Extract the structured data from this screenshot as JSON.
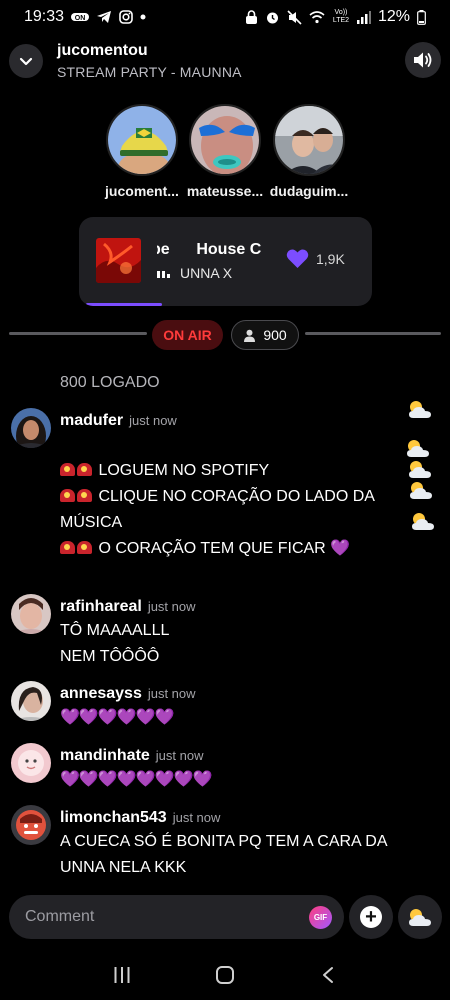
{
  "status_bar": {
    "time": "19:33",
    "lte_label": "Vo)) LTE2",
    "battery": "12%"
  },
  "header": {
    "host": "jucomentou",
    "party_title": "STREAM PARTY - MAUNNA"
  },
  "participants": [
    {
      "name": "jucoment...",
      "icon": "cap-avatar"
    },
    {
      "name": "mateusse...",
      "icon": "face-avatar"
    },
    {
      "name": "dudaguim...",
      "icon": "photo-avatar"
    }
  ],
  "now_playing": {
    "title": "pe      House C",
    "artist": "UNNA X",
    "likes": "1,9K",
    "progress_percent": 26
  },
  "live": {
    "onair_label": "ON AIR",
    "viewers": "900"
  },
  "chat": {
    "note": "800 LOGADO",
    "messages": [
      {
        "user": "madufer",
        "time": "just now",
        "lines": [
          "LOGUEM NO SPOTIFY",
          "CLIQUE NO CORAÇÃO DO LADO DA",
          "MÚSICA",
          "O CORAÇÃO TEM QUE FICAR"
        ]
      },
      {
        "user": "rafinhareal",
        "time": "just now",
        "lines": [
          "TÔ MAAAALLL",
          "NEM TÔÔÔÔ"
        ]
      },
      {
        "user": "annesayss",
        "time": "just now",
        "lines": [
          "💜💜💜💜💜💜"
        ]
      },
      {
        "user": "mandinhate",
        "time": "just now",
        "lines": [
          "💜💜💜💜💜💜💜💜"
        ]
      },
      {
        "user": "limonchan543",
        "time": "just now",
        "lines": [
          "A CUECA SÓ É BONITA PQ TEM A CARA DA",
          "UNNA NELA KKK"
        ]
      }
    ],
    "heart_emoji": "💜"
  },
  "composer": {
    "placeholder": "Comment",
    "gif_label": "GIF"
  },
  "colors": {
    "accent": "#7c4dff",
    "onair_text": "#ff3b3b",
    "onair_bg": "#4a0d10",
    "heart": "#9b4dff"
  }
}
